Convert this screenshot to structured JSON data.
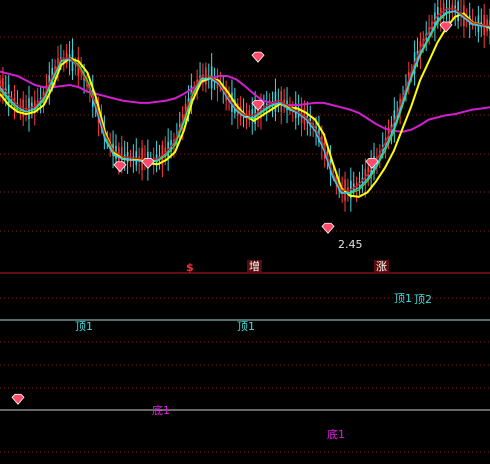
{
  "chart_data": {
    "type": "line",
    "upper_panel": {
      "y_range": [
        2.3,
        4.5
      ],
      "price_annotation": "2.45",
      "series": [
        {
          "key": "ma_magenta",
          "color": "#d020d0",
          "values": [
            3.86,
            3.84,
            3.82,
            3.78,
            3.74,
            3.72,
            3.72,
            3.73,
            3.74,
            3.72,
            3.68,
            3.66,
            3.64,
            3.62,
            3.6,
            3.59,
            3.58,
            3.58,
            3.59,
            3.6,
            3.62,
            3.66,
            3.71,
            3.76,
            3.8,
            3.82,
            3.82,
            3.79,
            3.73,
            3.66,
            3.6,
            3.58,
            3.57,
            3.56,
            3.56,
            3.57,
            3.58,
            3.58,
            3.56,
            3.54,
            3.52,
            3.49,
            3.44,
            3.39,
            3.35,
            3.33,
            3.32,
            3.34,
            3.38,
            3.43,
            3.45,
            3.47,
            3.48,
            3.5,
            3.52,
            3.53,
            3.54
          ]
        },
        {
          "key": "ma_yellow",
          "color": "#ffff00",
          "values": [
            3.66,
            3.56,
            3.5,
            3.48,
            3.5,
            3.56,
            3.72,
            3.92,
            3.98,
            3.95,
            3.85,
            3.62,
            3.32,
            3.14,
            3.08,
            3.07,
            3.07,
            3.04,
            3.03,
            3.07,
            3.14,
            3.33,
            3.6,
            3.77,
            3.8,
            3.78,
            3.68,
            3.56,
            3.47,
            3.42,
            3.47,
            3.52,
            3.57,
            3.54,
            3.53,
            3.49,
            3.43,
            3.3,
            3.05,
            2.82,
            2.75,
            2.74,
            2.78,
            2.88,
            3.0,
            3.15,
            3.35,
            3.55,
            3.78,
            3.95,
            4.12,
            4.25,
            4.35,
            4.38,
            4.3,
            4.28,
            4.25
          ]
        },
        {
          "key": "ma_green",
          "color": "#30e030",
          "values": [
            3.7,
            3.6,
            3.52,
            3.5,
            3.52,
            3.6,
            3.78,
            3.95,
            3.98,
            3.92,
            3.78,
            3.55,
            3.27,
            3.12,
            3.08,
            3.07,
            3.06,
            3.05,
            3.06,
            3.11,
            3.2,
            3.4,
            3.65,
            3.79,
            3.8,
            3.76,
            3.64,
            3.52,
            3.45,
            3.44,
            3.5,
            3.55,
            3.58,
            3.53,
            3.5,
            3.45,
            3.36,
            3.2,
            2.95,
            2.78,
            2.77,
            2.8,
            2.88,
            3.0,
            3.15,
            3.32,
            3.55,
            3.8,
            4.0,
            4.15,
            4.3,
            4.38,
            4.4,
            4.35,
            4.28,
            4.27,
            4.26
          ]
        },
        {
          "key": "ma_cyan",
          "color": "#40c0ff",
          "values": [
            3.72,
            3.62,
            3.54,
            3.5,
            3.53,
            3.62,
            3.8,
            3.96,
            3.97,
            3.9,
            3.75,
            3.52,
            3.25,
            3.11,
            3.08,
            3.07,
            3.06,
            3.05,
            3.07,
            3.13,
            3.23,
            3.43,
            3.67,
            3.8,
            3.8,
            3.75,
            3.62,
            3.51,
            3.45,
            3.45,
            3.51,
            3.56,
            3.58,
            3.52,
            3.49,
            3.43,
            3.33,
            3.16,
            2.92,
            2.77,
            2.78,
            2.82,
            2.9,
            3.02,
            3.18,
            3.35,
            3.58,
            3.82,
            4.02,
            4.17,
            4.32,
            4.39,
            4.4,
            4.34,
            4.28,
            4.27,
            4.26
          ]
        },
        {
          "key": "ma_red",
          "color": "#c02020",
          "values": [
            3.75,
            3.65,
            3.56,
            3.52,
            3.55,
            3.64,
            3.82,
            3.98,
            3.98,
            3.9,
            3.75,
            3.55,
            3.3,
            3.15,
            3.1,
            3.09,
            3.08,
            3.07,
            3.08,
            3.14,
            3.24,
            3.45,
            3.68,
            3.82,
            3.82,
            3.76,
            3.64,
            3.53,
            3.47,
            3.47,
            3.53,
            3.58,
            3.6,
            3.55,
            3.5,
            3.45,
            3.36,
            3.2,
            2.96,
            2.8,
            2.8,
            2.85,
            2.94,
            3.06,
            3.22,
            3.4,
            3.62,
            3.86,
            4.06,
            4.22,
            4.36,
            4.42,
            4.42,
            4.36,
            4.3,
            4.28,
            4.27
          ]
        }
      ],
      "diamond_markers": [
        0.92,
        3.0,
        3.03,
        3.55,
        4.25,
        2.45,
        3.03,
        3.98
      ]
    },
    "signal_labels": [
      "$",
      "增",
      "涨"
    ],
    "indicator_labels": [
      "顶1",
      "顶2",
      "顶1",
      "顶1",
      "底1",
      "底1"
    ]
  },
  "colors": {
    "background": "#000000",
    "grid": "#8b1a1a",
    "divider_red": "#c0182a",
    "divider_white": "#d0d0d0",
    "cyan": "#40e0e0",
    "magenta": "#e020e0"
  }
}
